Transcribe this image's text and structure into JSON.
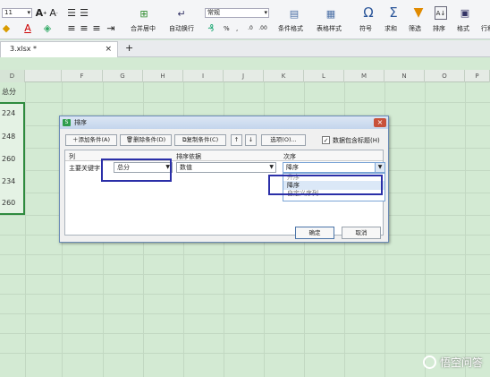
{
  "ribbon": {
    "font_size": "11",
    "merge_center": "合并居中",
    "wrap_text": "自动换行",
    "number_format": "常规",
    "percent": "%",
    "comma": ",",
    "cond_format": "条件格式",
    "table_style": "表格样式",
    "symbol": "符号",
    "sum": "求和",
    "filter": "筛选",
    "sort": "排序",
    "format": "格式",
    "row_col": "行和"
  },
  "file_tab": {
    "name": "3.xlsx *"
  },
  "sheet": {
    "columns": [
      "D",
      "F",
      "G",
      "H",
      "I",
      "J",
      "K",
      "L",
      "M",
      "N",
      "O",
      "P"
    ],
    "header_cell": "总分",
    "values": [
      "224",
      "248",
      "260",
      "234",
      "260"
    ]
  },
  "dialog": {
    "title": "排序",
    "add_condition": "添加条件(A)",
    "delete_condition": "删除条件(D)",
    "copy_condition": "复制条件(C)",
    "options": "选项(O)...",
    "header_checkbox": "数据包含标题(H)",
    "col_header": "列",
    "sort_basis_header": "排序依据",
    "order_header": "次序",
    "primary_key_label": "主要关键字",
    "primary_key_value": "总分",
    "sort_basis_value": "数值",
    "order_value": "降序",
    "order_options": [
      "升序",
      "降序",
      "自定义序列..."
    ],
    "ok": "确定",
    "cancel": "取消"
  },
  "watermark": "悟空问答"
}
